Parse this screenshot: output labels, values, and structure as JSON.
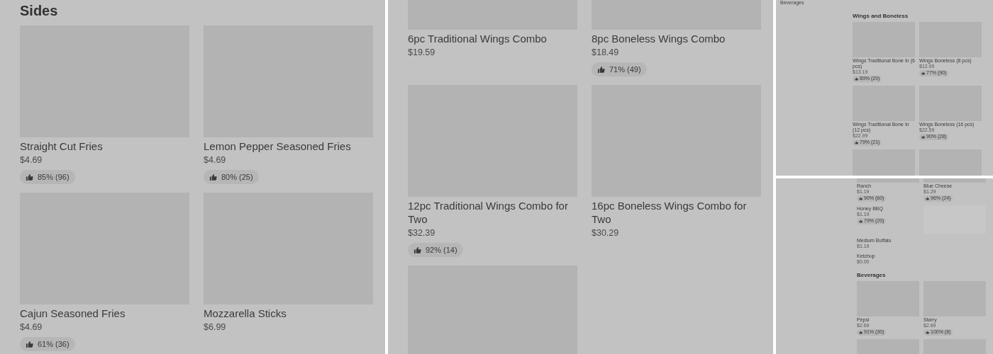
{
  "panels": [
    {
      "sections": [
        {
          "title": "Sides",
          "items": [
            {
              "kind": "photo",
              "name": "Straight Cut Fries",
              "price": "$4.69",
              "rating": "85% (96)"
            },
            {
              "kind": "photo",
              "name": "Lemon Pepper Seasoned Fries",
              "price": "$4.69",
              "rating": "80% (25)"
            },
            {
              "kind": "photo",
              "name": "Cajun Seasoned Fries",
              "price": "$4.69",
              "rating": "61% (36)"
            },
            {
              "kind": "photo",
              "name": "Mozzarella Sticks",
              "price": "$6.99"
            }
          ]
        }
      ]
    },
    {
      "sections": [
        {
          "items": [
            {
              "kind": "photo",
              "name": "6pc Traditional Wings Combo",
              "price": "$19.59"
            },
            {
              "kind": "photo",
              "name": "8pc Boneless Wings Combo",
              "price": "$18.49",
              "rating": "71% (49)"
            },
            {
              "kind": "photo",
              "name": "12pc Traditional Wings Combo for Two",
              "price": "$32.39",
              "rating": "92% (14)"
            },
            {
              "kind": "photo",
              "name": "16pc Boneless Wings Combo for Two",
              "price": "$30.29"
            },
            {
              "kind": "image_only"
            }
          ]
        }
      ]
    },
    {
      "caption": "Beverages",
      "sections": [
        {
          "title": "Wings and Boneless",
          "items": [
            {
              "kind": "photo",
              "name": "Wings Traditional Bone In (6 pcs)",
              "price": "$13.19",
              "rating": "89% (20)"
            },
            {
              "kind": "photo",
              "name": "Wings Boneless (8 pcs)",
              "price": "$12.99",
              "rating": "77% (90)"
            },
            {
              "kind": "photo",
              "name": "Wings Traditional Bone In (12 pcs)",
              "price": "$22.99",
              "rating": "79% (21)"
            },
            {
              "kind": "photo",
              "name": "Wings Boneless (16 pcs)",
              "price": "$22.59",
              "rating": "90% (28)"
            },
            {
              "kind": "image_only"
            },
            {
              "kind": "image_only"
            }
          ]
        }
      ]
    },
    {
      "sections": [
        {
          "items": [
            {
              "kind": "photo",
              "name": "Ranch",
              "price": "$1.19",
              "rating": "90% (60)"
            },
            {
              "kind": "photo",
              "name": "Blue Cheese",
              "price": "$1.29",
              "rating": "96% (24)"
            },
            {
              "kind": "text",
              "name": "Honey BBQ",
              "price": "$1.19",
              "rating": "79% (20)"
            },
            {
              "kind": "faint"
            },
            {
              "kind": "text",
              "name": "Medium Buffalo",
              "price": "$1.19"
            },
            {
              "kind": "text",
              "name": "Ketchup",
              "price": "$0.00"
            }
          ]
        },
        {
          "title": "Beverages",
          "items": [
            {
              "kind": "photo",
              "name": "Pepsi",
              "price": "$2.69",
              "rating": "91% (30)"
            },
            {
              "kind": "photo",
              "name": "Starry",
              "price": "$2.69",
              "rating": "100% (8)"
            },
            {
              "kind": "image_only"
            },
            {
              "kind": "image_only"
            }
          ]
        }
      ]
    }
  ]
}
